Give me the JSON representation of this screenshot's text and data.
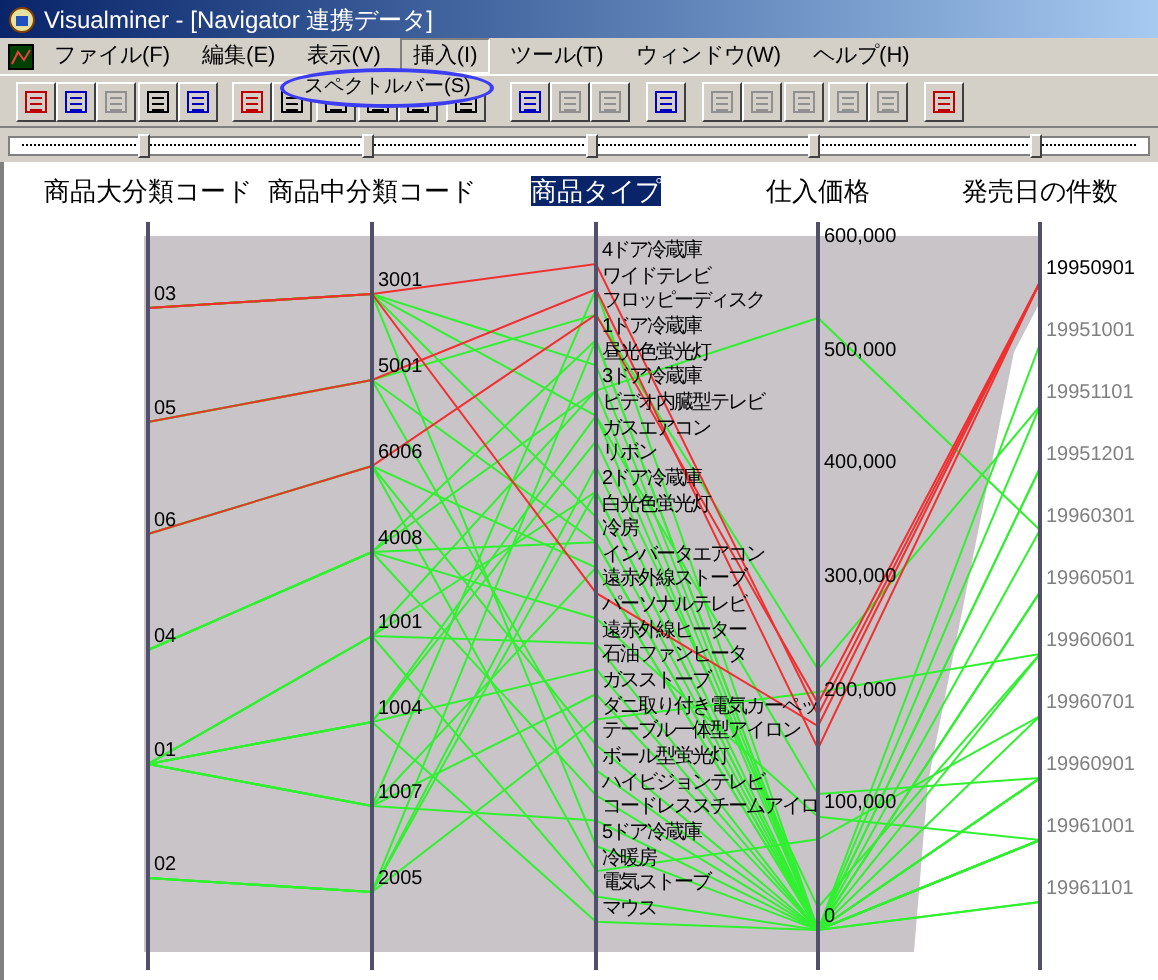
{
  "window": {
    "title": "Visualminer - [Navigator 連携データ]"
  },
  "menu": [
    {
      "label": "ファイル(F)",
      "selected": false
    },
    {
      "label": "編集(E)",
      "selected": false
    },
    {
      "label": "表示(V)",
      "selected": false
    },
    {
      "label": "挿入(I)",
      "selected": true
    },
    {
      "label": "ツール(T)",
      "selected": false
    },
    {
      "label": "ウィンドウ(W)",
      "selected": false
    },
    {
      "label": "ヘルプ(H)",
      "selected": false
    }
  ],
  "dropdown": {
    "items": [
      "スペクトルバー(S)"
    ]
  },
  "axes": [
    {
      "title": "商品大分類コード",
      "selected": false,
      "labels": [
        {
          "text": "03",
          "highlighted": true
        },
        {
          "text": "05",
          "highlighted": true
        },
        {
          "text": "06",
          "highlighted": true
        },
        {
          "text": "04",
          "highlighted": true
        },
        {
          "text": "01",
          "highlighted": true
        },
        {
          "text": "02",
          "highlighted": true
        }
      ]
    },
    {
      "title": "商品中分類コード",
      "selected": false,
      "labels": [
        {
          "text": "3001",
          "highlighted": true
        },
        {
          "text": "5001",
          "highlighted": true
        },
        {
          "text": "6006",
          "highlighted": true
        },
        {
          "text": "4008",
          "highlighted": true
        },
        {
          "text": "1001",
          "highlighted": true
        },
        {
          "text": "1004",
          "highlighted": true
        },
        {
          "text": "1007",
          "highlighted": true
        },
        {
          "text": "2005",
          "highlighted": true
        }
      ]
    },
    {
      "title": "商品タイプ",
      "selected": true,
      "labels": [
        {
          "text": "4ドア冷蔵庫",
          "highlighted": true
        },
        {
          "text": "ワイドテレビ",
          "highlighted": true
        },
        {
          "text": "フロッピーディスク",
          "highlighted": true
        },
        {
          "text": "1ドア冷蔵庫",
          "highlighted": true
        },
        {
          "text": "昼光色蛍光灯",
          "highlighted": true
        },
        {
          "text": "3ドア冷蔵庫",
          "highlighted": true
        },
        {
          "text": "ビデオ内臓型テレビ",
          "highlighted": true
        },
        {
          "text": "ガスエアコン",
          "highlighted": true
        },
        {
          "text": "リボン",
          "highlighted": true
        },
        {
          "text": "2ドア冷蔵庫",
          "highlighted": true
        },
        {
          "text": "白光色蛍光灯",
          "highlighted": true
        },
        {
          "text": "冷房",
          "highlighted": true
        },
        {
          "text": "インバータエアコン",
          "highlighted": true
        },
        {
          "text": "遠赤外線ストーブ",
          "highlighted": true
        },
        {
          "text": "パーソナルテレビ",
          "highlighted": true
        },
        {
          "text": "遠赤外線ヒーター",
          "highlighted": true
        },
        {
          "text": "石油ファンヒータ",
          "highlighted": true
        },
        {
          "text": "ガスストーブ",
          "highlighted": true
        },
        {
          "text": "ダニ取り付き電気カーペッ",
          "highlighted": true
        },
        {
          "text": "テーブル一体型アイロン",
          "highlighted": true
        },
        {
          "text": "ボール型蛍光灯",
          "highlighted": true
        },
        {
          "text": "ハイビジョンテレビ",
          "highlighted": true
        },
        {
          "text": "コードレススチームアイロ",
          "highlighted": true
        },
        {
          "text": "5ドア冷蔵庫",
          "highlighted": true
        },
        {
          "text": "冷暖房",
          "highlighted": true
        },
        {
          "text": "電気ストーブ",
          "highlighted": true
        },
        {
          "text": "マウス",
          "highlighted": true
        }
      ]
    },
    {
      "title": "仕入価格",
      "selected": false,
      "labels": [
        {
          "text": "600,000",
          "highlighted": true
        },
        {
          "text": "500,000",
          "highlighted": true
        },
        {
          "text": "400,000",
          "highlighted": true
        },
        {
          "text": "300,000",
          "highlighted": true
        },
        {
          "text": "200,000",
          "highlighted": true
        },
        {
          "text": "100,000",
          "highlighted": true
        },
        {
          "text": "0",
          "highlighted": true
        }
      ]
    },
    {
      "title": "発売日の件数",
      "selected": false,
      "labels": [
        {
          "text": "19950901",
          "highlighted": true
        },
        {
          "text": "19951001",
          "highlighted": false
        },
        {
          "text": "19951101",
          "highlighted": false
        },
        {
          "text": "19951201",
          "highlighted": false
        },
        {
          "text": "19960301",
          "highlighted": false
        },
        {
          "text": "19960501",
          "highlighted": false
        },
        {
          "text": "19960601",
          "highlighted": false
        },
        {
          "text": "19960701",
          "highlighted": false
        },
        {
          "text": "19960901",
          "highlighted": false
        },
        {
          "text": "19961001",
          "highlighted": false
        },
        {
          "text": "19961101",
          "highlighted": false
        }
      ]
    }
  ]
}
